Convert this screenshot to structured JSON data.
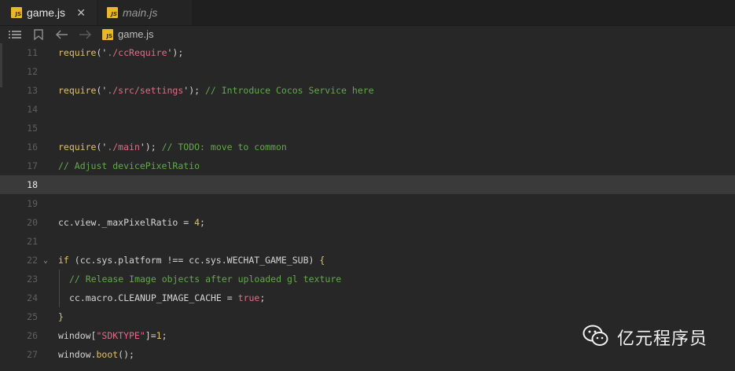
{
  "tabs": [
    {
      "label": "game.js",
      "icon": "js-file-icon",
      "close": "✕"
    },
    {
      "label": "main.js",
      "icon": "js-file-icon"
    }
  ],
  "toolbar": {
    "breadcrumb": "game.js",
    "icons": [
      "list-icon",
      "bookmark-icon",
      "back-arrow-icon",
      "forward-arrow-icon"
    ]
  },
  "editor": {
    "current_line": 18,
    "lines": [
      {
        "n": "11",
        "tokens": [
          [
            "fn",
            "require"
          ],
          [
            "punc",
            "('"
          ],
          [
            "str",
            "./ccRequire"
          ],
          [
            "punc",
            "');"
          ]
        ]
      },
      {
        "n": "12",
        "tokens": []
      },
      {
        "n": "13",
        "tokens": [
          [
            "fn",
            "require"
          ],
          [
            "punc",
            "('"
          ],
          [
            "str",
            "./src/settings"
          ],
          [
            "punc",
            "'); "
          ],
          [
            "com",
            "// Introduce Cocos Service here"
          ]
        ]
      },
      {
        "n": "14",
        "tokens": []
      },
      {
        "n": "15",
        "tokens": []
      },
      {
        "n": "16",
        "tokens": [
          [
            "fn",
            "require"
          ],
          [
            "punc",
            "('"
          ],
          [
            "str",
            "./main"
          ],
          [
            "punc",
            "'); "
          ],
          [
            "com",
            "// TODO: move to common"
          ]
        ]
      },
      {
        "n": "17",
        "tokens": [
          [
            "com",
            "// Adjust devicePixelRatio"
          ]
        ]
      },
      {
        "n": "18",
        "tokens": []
      },
      {
        "n": "19",
        "tokens": []
      },
      {
        "n": "20",
        "tokens": [
          [
            "punc",
            "cc.view._maxPixelRatio = "
          ],
          [
            "num",
            "4"
          ],
          [
            "punc",
            ";"
          ]
        ]
      },
      {
        "n": "21",
        "tokens": []
      },
      {
        "n": "22",
        "fold": "❯",
        "tokens": [
          [
            "fn",
            "if"
          ],
          [
            "punc",
            " (cc.sys.platform !== cc.sys.WECHAT_GAME_SUB) "
          ],
          [
            "fn",
            "{"
          ]
        ]
      },
      {
        "n": "23",
        "indent": true,
        "tokens": [
          [
            "com",
            "// Release Image objects after uploaded gl texture"
          ]
        ]
      },
      {
        "n": "24",
        "indent": true,
        "tokens": [
          [
            "punc",
            "cc.macro.CLEANUP_IMAGE_CACHE = "
          ],
          [
            "str",
            "true"
          ],
          [
            "punc",
            ";"
          ]
        ]
      },
      {
        "n": "25",
        "tokens": [
          [
            "fn",
            "}"
          ]
        ]
      },
      {
        "n": "26",
        "tokens": [
          [
            "punc",
            "window["
          ],
          [
            "str",
            "\"SDKTYPE\""
          ],
          [
            "punc",
            "]="
          ],
          [
            "num",
            "1"
          ],
          [
            "punc",
            ";"
          ]
        ]
      },
      {
        "n": "27",
        "tokens": [
          [
            "punc",
            "window."
          ],
          [
            "fn",
            "boot"
          ],
          [
            "punc",
            "();"
          ]
        ]
      }
    ]
  },
  "watermark": {
    "text": "亿元程序员",
    "icon": "wechat-icon"
  }
}
